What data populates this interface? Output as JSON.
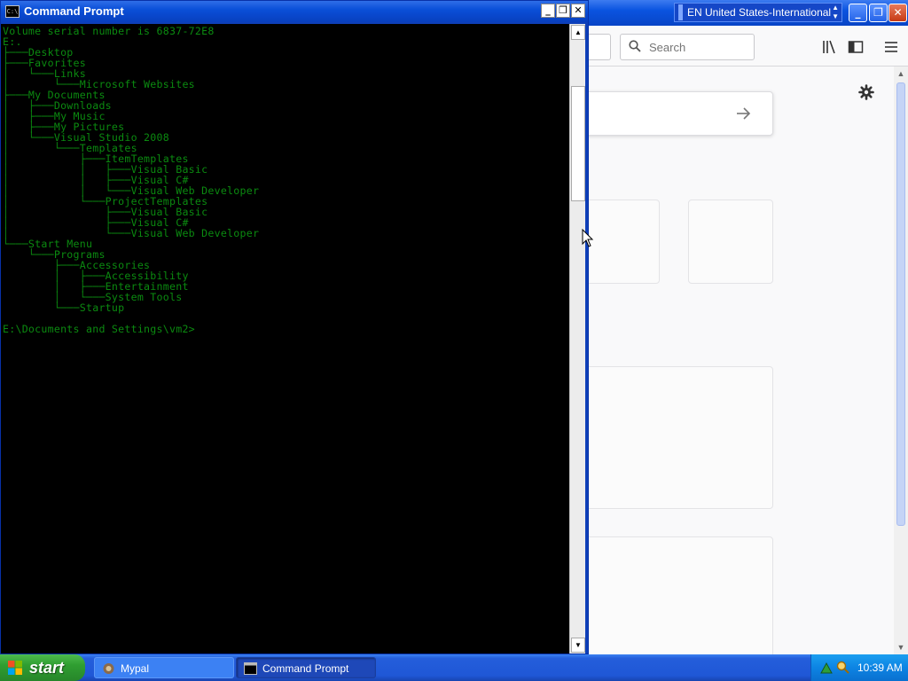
{
  "browser": {
    "language_bar": "EN United States-International",
    "search_placeholder": "Search"
  },
  "cmd": {
    "title": "Command Prompt",
    "icon_text": "C:\\",
    "output_lines": [
      "Volume serial number is 6837-72E8",
      "E:.",
      "├───Desktop",
      "├───Favorites",
      "│   └───Links",
      "│       └───Microsoft Websites",
      "├───My Documents",
      "│   ├───Downloads",
      "│   ├───My Music",
      "│   ├───My Pictures",
      "│   └───Visual Studio 2008",
      "│       └───Templates",
      "│           ├───ItemTemplates",
      "│           │   ├───Visual Basic",
      "│           │   ├───Visual C#",
      "│           │   └───Visual Web Developer",
      "│           └───ProjectTemplates",
      "│               ├───Visual Basic",
      "│               ├───Visual C#",
      "│               └───Visual Web Developer",
      "└───Start Menu",
      "    └───Programs",
      "        ├───Accessories",
      "        │   ├───Accessibility",
      "        │   ├───Entertainment",
      "        │   └───System Tools",
      "        └───Startup",
      "",
      "E:\\Documents and Settings\\vm2>"
    ],
    "text_color": "#0b8a10"
  },
  "taskbar": {
    "start_label": "start",
    "tasks": [
      {
        "label": "Mypal"
      },
      {
        "label": "Command Prompt"
      }
    ],
    "clock": "10:39 AM"
  }
}
